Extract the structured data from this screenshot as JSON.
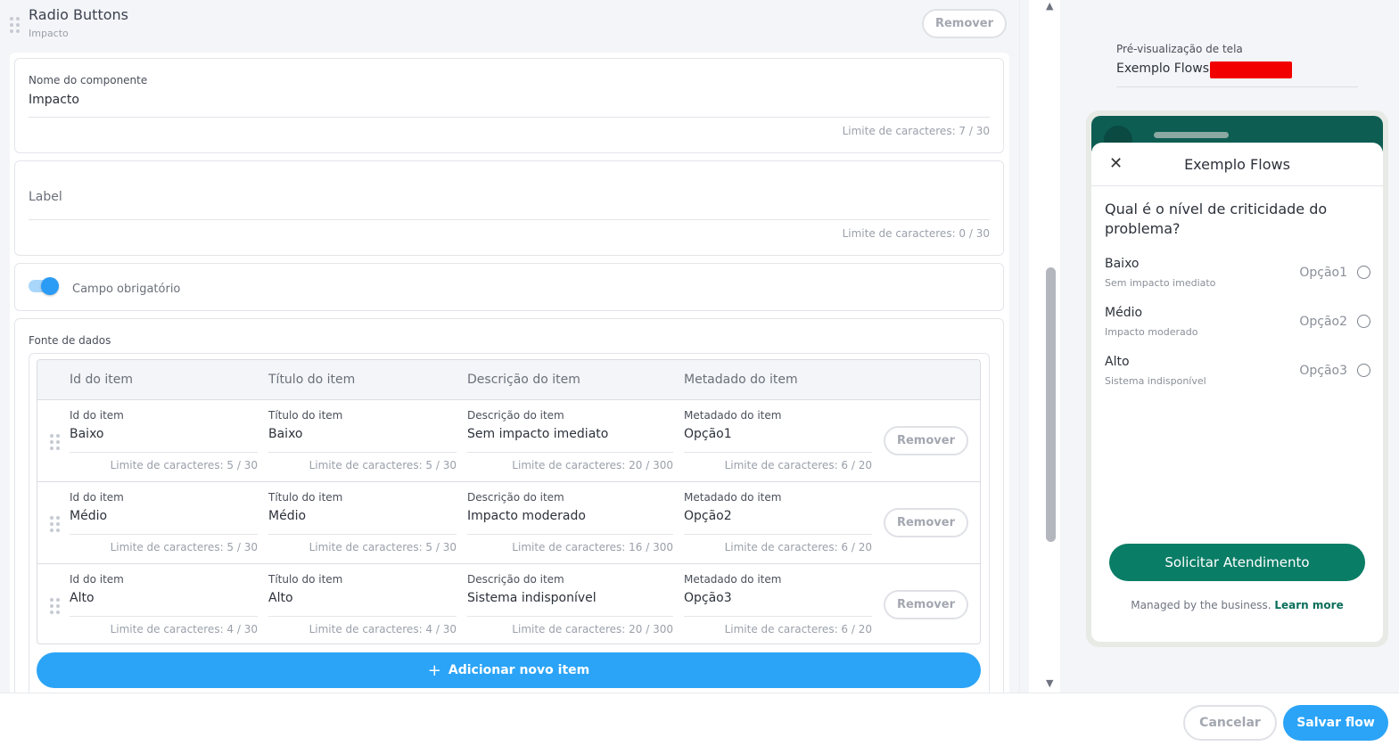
{
  "component": {
    "title": "Radio Buttons",
    "subtitle": "Impacto",
    "remove_label": "Remover"
  },
  "name_field": {
    "label": "Nome do componente",
    "value": "Impacto",
    "limit": "Limite de caracteres: 7 / 30"
  },
  "label_field": {
    "label": "Label",
    "limit": "Limite de caracteres: 0 / 30"
  },
  "required_toggle": {
    "label": "Campo obrigatório",
    "on": true
  },
  "data_source": {
    "label": "Fonte de dados",
    "headers": [
      "Id do item",
      "Título do item",
      "Descrição do item",
      "Metadado do item"
    ],
    "rows": [
      {
        "id": "Baixo",
        "id_limit": "Limite de caracteres: 5 / 30",
        "title": "Baixo",
        "title_limit": "Limite de caracteres: 5 / 30",
        "desc": "Sem impacto imediato",
        "desc_limit": "Limite de caracteres: 20 / 300",
        "meta": "Opção1",
        "meta_limit": "Limite de caracteres: 6 / 20"
      },
      {
        "id": "Médio",
        "id_limit": "Limite de caracteres: 5 / 30",
        "title": "Médio",
        "title_limit": "Limite de caracteres: 5 / 30",
        "desc": "Impacto moderado",
        "desc_limit": "Limite de caracteres: 16 / 300",
        "meta": "Opção2",
        "meta_limit": "Limite de caracteres: 6 / 20"
      },
      {
        "id": "Alto",
        "id_limit": "Limite de caracteres: 4 / 30",
        "title": "Alto",
        "title_limit": "Limite de caracteres: 4 / 30",
        "desc": "Sistema indisponível",
        "desc_limit": "Limite de caracteres: 20 / 300",
        "meta": "Opção3",
        "meta_limit": "Limite de caracteres: 6 / 20"
      }
    ],
    "row_remove_label": "Remover",
    "add_label": "Adicionar novo item",
    "add_icon": "+"
  },
  "preview": {
    "label": "Pré-visualização de tela",
    "title": "Exemplo Flows",
    "redacted_color": "#f20000",
    "sheet_title": "Exemplo Flows",
    "close_icon": "✕",
    "question": "Qual é o nível de criticidade do problema?",
    "options": [
      {
        "title": "Baixo",
        "desc": "Sem impacto imediato",
        "meta": "Opção1"
      },
      {
        "title": "Médio",
        "desc": "Impacto moderado",
        "meta": "Opção2"
      },
      {
        "title": "Alto",
        "desc": "Sistema indisponível",
        "meta": "Opção3"
      }
    ],
    "cta_label": "Solicitar Atendimento",
    "managed_text": "Managed by the business.",
    "learn_more": "Learn more"
  },
  "footer": {
    "cancel_label": "Cancelar",
    "save_label": "Salvar flow"
  },
  "colors": {
    "accent": "#2ba4f7",
    "whatsapp_green": "#0a7d66",
    "header_teal": "#0d5d52"
  }
}
